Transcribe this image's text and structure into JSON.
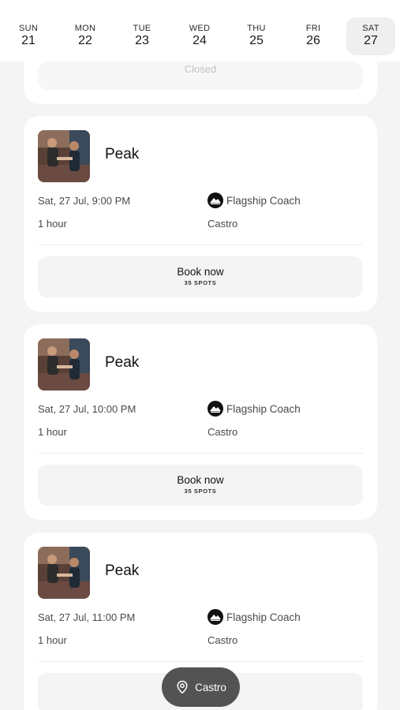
{
  "days": [
    {
      "name": "SUN",
      "num": "21"
    },
    {
      "name": "MON",
      "num": "22"
    },
    {
      "name": "TUE",
      "num": "23"
    },
    {
      "name": "WED",
      "num": "24"
    },
    {
      "name": "THU",
      "num": "25"
    },
    {
      "name": "FRI",
      "num": "26"
    },
    {
      "name": "SAT",
      "num": "27"
    }
  ],
  "selected_day": "SAT",
  "closed_card": {
    "label": "Closed"
  },
  "classes": [
    {
      "title": "Peak",
      "datetime": "Sat, 27 Jul, 9:00 PM",
      "duration": "1 hour",
      "coach": "Flagship Coach",
      "location": "Castro",
      "book_label": "Book now",
      "spots": "35 SPOTS"
    },
    {
      "title": "Peak",
      "datetime": "Sat, 27 Jul, 10:00 PM",
      "duration": "1 hour",
      "coach": "Flagship Coach",
      "location": "Castro",
      "book_label": "Book now",
      "spots": "35 SPOTS"
    },
    {
      "title": "Peak",
      "datetime": "Sat, 27 Jul, 11:00 PM",
      "duration": "1 hour",
      "coach": "Flagship Coach",
      "location": "Castro",
      "book_label": "",
      "spots": ""
    }
  ],
  "location_pill": {
    "label": "Castro",
    "icon": "map-pin-icon"
  },
  "colors": {
    "page_bg": "#f4f4f4",
    "card_bg": "#ffffff",
    "pill_bg": "#535353",
    "selected_day_bg": "#efefef"
  }
}
